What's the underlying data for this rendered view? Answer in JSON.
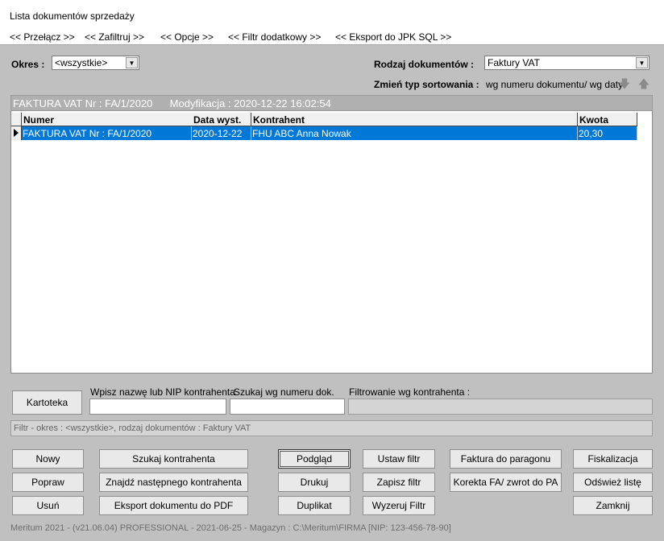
{
  "window": {
    "title": "Lista dokumentów sprzedaży"
  },
  "menu": [
    "<< Przełącz >>",
    "<< Zafiltruj >>",
    "<< Opcje >>",
    "<< Filtr dodatkowy >>",
    "<< Eksport do JPK SQL >>"
  ],
  "filters": {
    "okres_label": "Okres :",
    "okres_value": "<wszystkie>",
    "rodzaj_label": "Rodzaj dokumentów :",
    "rodzaj_value": "Faktury VAT",
    "sort_label": "Zmień typ sortowania :",
    "sort_value": "wg numeru dokumentu/ wg daty",
    "sort_down_icon": "arrow-down-icon",
    "sort_up_icon": "arrow-up-icon"
  },
  "info": {
    "document": "FAKTURA VAT Nr : FA/1/2020",
    "modified": "Modyfikacja : 2020-12-22  16:02:54"
  },
  "table": {
    "columns": [
      "Numer",
      "Data wyst.",
      "Kontrahent",
      "Kwota"
    ],
    "rows": [
      {
        "numer": "FAKTURA VAT Nr : FA/1/2020",
        "data": "2020-12-22",
        "kontrahent": "FHU ABC Anna Nowak",
        "kwota": "20,30",
        "selected": true
      }
    ]
  },
  "search": {
    "kartoteka_label": "Kartoteka",
    "contractor_label": "Wpisz nazwę lub NIP kontrahenta",
    "contractor_value": "",
    "docnum_label": "Szukaj wg numeru dok.",
    "docnum_value": "",
    "filter_contractor_label": "Filtrowanie wg kontrahenta :",
    "filter_contractor_value": ""
  },
  "filter_summary": "Filtr - okres : <wszystkie>,  rodzaj dokumentów : Faktury VAT",
  "buttons": {
    "nowy": "Nowy",
    "popraw": "Popraw",
    "usun": "Usuń",
    "szukaj_kontrahenta": "Szukaj kontrahenta",
    "znajdz_nastepnego": "Znajdź następnego kontrahenta",
    "eksport_pdf": "Eksport dokumentu do PDF",
    "podglad": "Podgląd",
    "drukuj": "Drukuj",
    "duplikat": "Duplikat",
    "ustaw_filtr": "Ustaw filtr",
    "zapisz_filtr": "Zapisz filtr",
    "wyzeruj_filtr": "Wyzeruj Filtr",
    "faktura_do_paragonu": "Faktura do paragonu",
    "korekta": "Korekta FA/ zwrot do PA",
    "fiskalizacja": "Fiskalizacja",
    "odswiez": "Odśwież listę",
    "zamknij": "Zamknij"
  },
  "status": "Meritum 2021   -  (v21.06.04) PROFESSIONAL  -  2021-06-25  -  Magazyn :  C:\\Meritum\\FIRMA   [NIP: 123-456-78-90]"
}
